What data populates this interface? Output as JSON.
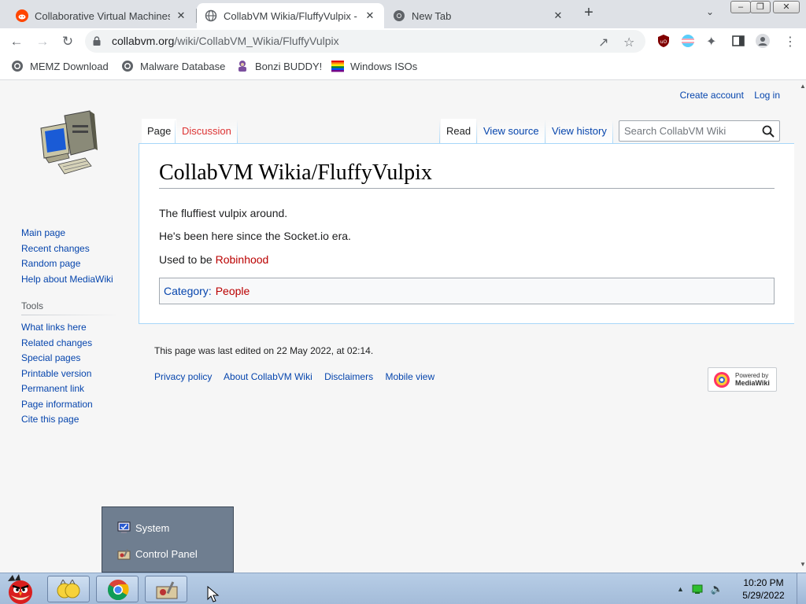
{
  "browser": {
    "tabs": [
      {
        "title": "Collaborative Virtual Machines",
        "active": false
      },
      {
        "title": "CollabVM Wikia/FluffyVulpix - CollabVM Wiki",
        "active": true
      },
      {
        "title": "New Tab",
        "active": false
      }
    ],
    "url_host": "collabvm.org",
    "url_path": "/wiki/CollabVM_Wikia/FluffyVulpix",
    "bookmarks": [
      "MEMZ Download",
      "Malware Database",
      "Bonzi BUDDY!",
      "Windows ISOs"
    ]
  },
  "wiki": {
    "personal": {
      "create_account": "Create account",
      "log_in": "Log in"
    },
    "tabs": {
      "page": "Page",
      "discussion": "Discussion",
      "read": "Read",
      "view_source": "View source",
      "view_history": "View history"
    },
    "search_placeholder": "Search CollabVM Wiki",
    "title": "CollabVM Wikia/FluffyVulpix",
    "paragraphs": {
      "p1": "The fluffiest vulpix around.",
      "p2": "He's been here since the Socket.io era.",
      "p3_prefix": "Used to be ",
      "p3_link": "Robinhood"
    },
    "category": {
      "label": "Category",
      "separator": ":",
      "value": "People"
    },
    "nav": [
      "Main page",
      "Recent changes",
      "Random page",
      "Help about MediaWiki"
    ],
    "tools_heading": "Tools",
    "tools": [
      "What links here",
      "Related changes",
      "Special pages",
      "Printable version",
      "Permanent link",
      "Page information",
      "Cite this page"
    ],
    "footer": {
      "last_edited": "This page was last edited on 22 May 2022, at 02:14.",
      "links": [
        "Privacy policy",
        "About CollabVM Wiki",
        "Disclaimers",
        "Mobile view"
      ],
      "powered_by": {
        "line1": "Powered by",
        "line2": "MediaWiki"
      }
    }
  },
  "popup": {
    "items": [
      "System",
      "Control Panel"
    ]
  },
  "taskbar": {
    "time": "10:20 PM",
    "date": "5/29/2022"
  },
  "colors": {
    "link": "#0645ad",
    "redlink": "#ba0000",
    "taskbar": "#a4bcd9"
  }
}
